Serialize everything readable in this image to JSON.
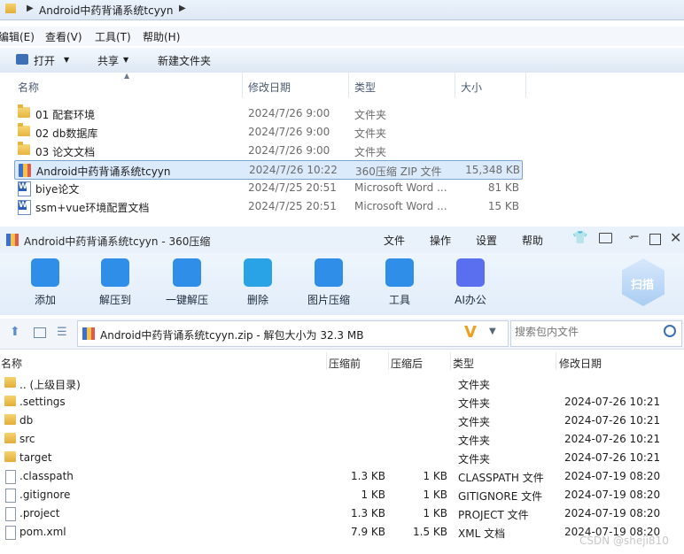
{
  "explorer": {
    "breadcrumb": "Android中药背诵系统tcyyn",
    "menu": [
      "编辑(E)",
      "查看(V)",
      "工具(T)",
      "帮助(H)"
    ],
    "toolbar": {
      "open": "打开",
      "share": "共享",
      "new_folder": "新建文件夹"
    },
    "columns": {
      "name": "名称",
      "date": "修改日期",
      "type": "类型",
      "size": "大小"
    },
    "rows": [
      {
        "name": "01 配套环境",
        "date": "2024/7/26 9:00",
        "type": "文件夹",
        "size": "",
        "icon": "folder-icon"
      },
      {
        "name": "02 db数据库",
        "date": "2024/7/26 9:00",
        "type": "文件夹",
        "size": "",
        "icon": "folder-icon"
      },
      {
        "name": "03 论文文档",
        "date": "2024/7/26 9:00",
        "type": "文件夹",
        "size": "",
        "icon": "folder-icon"
      },
      {
        "name": "Android中药背诵系统tcyyn",
        "date": "2024/7/26 10:22",
        "type": "360压缩 ZIP 文件",
        "size": "15,348 KB",
        "icon": "zip-icon"
      },
      {
        "name": "biye论文",
        "date": "2024/7/25 20:51",
        "type": "Microsoft Word ...",
        "size": "81 KB",
        "icon": "word-icon"
      },
      {
        "name": "ssm+vue环境配置文档",
        "date": "2024/7/25 20:51",
        "type": "Microsoft Word ...",
        "size": "15 KB",
        "icon": "word-icon"
      }
    ]
  },
  "zip": {
    "title": "Android中药背诵系统tcyyn - 360压缩",
    "menu": [
      "文件",
      "操作",
      "设置",
      "帮助"
    ],
    "toolbar": [
      {
        "label": "添加",
        "icon": "add-icon",
        "color": "#2f8fe8"
      },
      {
        "label": "解压到",
        "icon": "extract-to-icon",
        "color": "#2f8fe8"
      },
      {
        "label": "一键解压",
        "icon": "quick-extract-icon",
        "color": "#2f8fe8"
      },
      {
        "label": "删除",
        "icon": "delete-icon",
        "color": "#2aa3e6"
      },
      {
        "label": "图片压缩",
        "icon": "image-compress-icon",
        "color": "#2f8fe8"
      },
      {
        "label": "工具",
        "icon": "tools-icon",
        "color": "#2f8fe8"
      },
      {
        "label": "AI办公",
        "icon": "ai-office-icon",
        "color": "#5a6ff0"
      }
    ],
    "scan_label": "扫描",
    "path_text": "Android中药背诵系统tcyyn.zip - 解包大小为 32.3 MB",
    "search_placeholder": "搜索包内文件",
    "columns": {
      "name": "名称",
      "before": "压缩前",
      "after": "压缩后",
      "type": "类型",
      "date": "修改日期"
    },
    "rows": [
      {
        "name": ".. (上级目录)",
        "before": "",
        "after": "",
        "type": "文件夹",
        "date": "",
        "icon": "folder-icon"
      },
      {
        "name": ".settings",
        "before": "",
        "after": "",
        "type": "文件夹",
        "date": "2024-07-26 10:21",
        "icon": "folder-icon"
      },
      {
        "name": "db",
        "before": "",
        "after": "",
        "type": "文件夹",
        "date": "2024-07-26 10:21",
        "icon": "folder-icon"
      },
      {
        "name": "src",
        "before": "",
        "after": "",
        "type": "文件夹",
        "date": "2024-07-26 10:21",
        "icon": "folder-icon"
      },
      {
        "name": "target",
        "before": "",
        "after": "",
        "type": "文件夹",
        "date": "2024-07-26 10:21",
        "icon": "folder-icon"
      },
      {
        "name": ".classpath",
        "before": "1.3 KB",
        "after": "1 KB",
        "type": "CLASSPATH 文件",
        "date": "2024-07-19 08:20",
        "icon": "file-icon"
      },
      {
        "name": ".gitignore",
        "before": "1 KB",
        "after": "1 KB",
        "type": "GITIGNORE 文件",
        "date": "2024-07-19 08:20",
        "icon": "file-icon"
      },
      {
        "name": ".project",
        "before": "1.3 KB",
        "after": "1 KB",
        "type": "PROJECT 文件",
        "date": "2024-07-19 08:20",
        "icon": "file-icon"
      },
      {
        "name": "pom.xml",
        "before": "7.9 KB",
        "after": "1.5 KB",
        "type": "XML 文档",
        "date": "2024-07-19 08:20",
        "icon": "xml-file-icon"
      }
    ],
    "watermark": "CSDN @sheji810"
  }
}
